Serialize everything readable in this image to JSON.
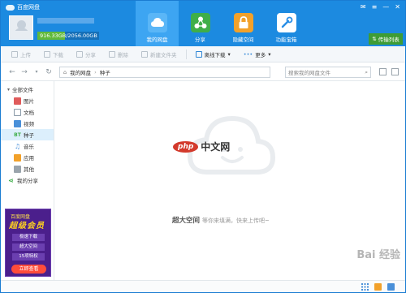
{
  "app": {
    "title": "百度网盘"
  },
  "account": {
    "quota_text": "916.33GB/2056.00GB",
    "quota_fraction": 0.446
  },
  "nav": {
    "tabs": [
      {
        "label": "我的网盘",
        "icon": "cloud-icon",
        "color": "#3da5f2"
      },
      {
        "label": "分享",
        "icon": "share-icon",
        "color": "#3fae49"
      },
      {
        "label": "隐藏空间",
        "icon": "lock-icon",
        "color": "#f2a12a"
      },
      {
        "label": "功能宝箱",
        "icon": "tools-icon",
        "color": "#2a8ee6"
      }
    ]
  },
  "transfer_label": "传输列表",
  "toolbar": {
    "upload": "上传",
    "download": "下载",
    "share": "分享",
    "delete": "删除",
    "new_folder": "新建文件夹",
    "offline": "离线下载",
    "more": "更多"
  },
  "address": {
    "root": "我的网盘",
    "current": "种子",
    "search_placeholder": "搜索我的网盘文件"
  },
  "sidebar": {
    "all_files": "全部文件",
    "items": [
      {
        "label": "图片",
        "icon": "image-icon",
        "color": "#e05b5b",
        "badge": ""
      },
      {
        "label": "文档",
        "icon": "document-icon",
        "color": "#8a9aa8",
        "badge": ""
      },
      {
        "label": "视频",
        "icon": "video-icon",
        "color": "#4a90d9",
        "badge": ""
      },
      {
        "label": "种子",
        "icon": "bt-icon",
        "color": "#3fae49",
        "badge": "BT"
      },
      {
        "label": "音乐",
        "icon": "music-icon",
        "color": "#4a90d9",
        "badge": ""
      },
      {
        "label": "应用",
        "icon": "app-icon",
        "color": "#f2a12a",
        "badge": ""
      },
      {
        "label": "其他",
        "icon": "other-icon",
        "color": "#9aa4ac",
        "badge": ""
      }
    ],
    "my_share": "我的分享"
  },
  "promo": {
    "line1": "百度网盘",
    "line2": "超级会员",
    "items": [
      "极速下载",
      "超大空间",
      "15项特权"
    ],
    "button": "立即查看"
  },
  "empty": {
    "strong": "超大空间",
    "rest": "等你来填满，快来上传吧~"
  },
  "watermark": {
    "php_logo": "php",
    "php_text": "中文网",
    "baidu": "Bai  经验"
  }
}
